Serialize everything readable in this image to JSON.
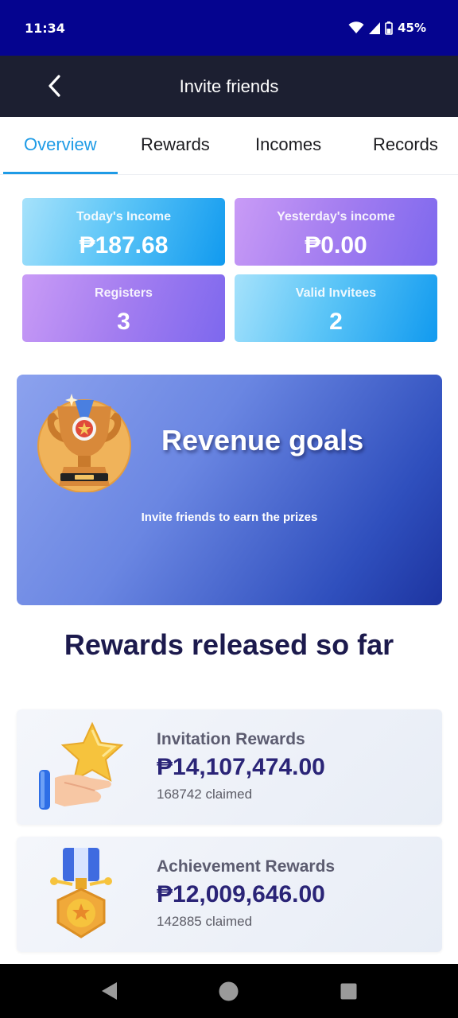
{
  "status_bar": {
    "time": "11:34",
    "battery": "45%"
  },
  "app_bar": {
    "title": "Invite friends"
  },
  "tabs": [
    {
      "label": "Overview",
      "active": true
    },
    {
      "label": "Rewards",
      "active": false
    },
    {
      "label": "Incomes",
      "active": false
    },
    {
      "label": "Records",
      "active": false
    }
  ],
  "stats": {
    "today_income": {
      "label": "Today's Income",
      "value": "₱187.68"
    },
    "yesterday_income": {
      "label": "Yesterday's income",
      "value": "₱0.00"
    },
    "registers": {
      "label": "Registers",
      "value": "3"
    },
    "valid_invitees": {
      "label": "Valid Invitees",
      "value": "2"
    }
  },
  "goals_banner": {
    "title": "Revenue goals",
    "subtitle": "Invite friends to earn the prizes",
    "icon": "trophy-icon"
  },
  "released": {
    "title": "Rewards released so far",
    "cards": [
      {
        "name": "Invitation Rewards",
        "amount": "₱14,107,474.00",
        "claimed": "168742 claimed",
        "icon": "star-hand-icon"
      },
      {
        "name": "Achievement Rewards",
        "amount": "₱12,009,646.00",
        "claimed": "142885 claimed",
        "icon": "medal-icon"
      }
    ]
  },
  "colors": {
    "status_bar": "#05048f",
    "app_bar": "#1c1f31",
    "accent": "#1e9be6",
    "heading": "#1c1a4d",
    "amount": "#2a2477"
  }
}
